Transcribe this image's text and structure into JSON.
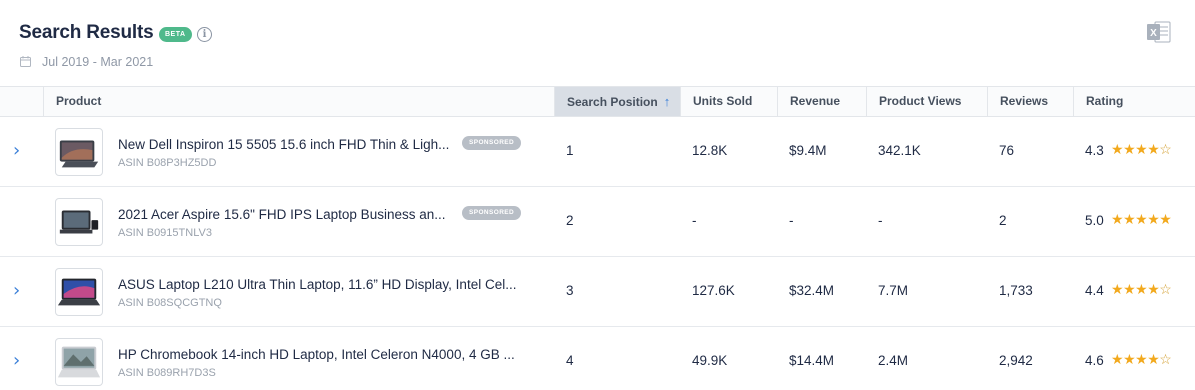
{
  "header": {
    "title": "Search Results",
    "beta_label": "BETA",
    "info_icon": "i",
    "date_range": "Jul 2019 - Mar 2021"
  },
  "columns": [
    {
      "label": "Product"
    },
    {
      "label": "Search Position",
      "sort": "ascending"
    },
    {
      "label": "Units Sold"
    },
    {
      "label": "Revenue"
    },
    {
      "label": "Product Views"
    },
    {
      "label": "Reviews"
    },
    {
      "label": "Rating"
    }
  ],
  "rows": [
    {
      "expandable": true,
      "name": "New Dell Inspiron 15 5505 15.6 inch FHD Thin & Ligh...",
      "asin": "ASIN B08P3HZ5DD",
      "sponsored": "SPONSORED",
      "position": "1",
      "units_sold": "12.8K",
      "revenue": "$9.4M",
      "product_views": "342.1K",
      "reviews": "76",
      "rating": "4.3",
      "stars": 4.3
    },
    {
      "expandable": false,
      "name": "2021 Acer Aspire 15.6\" FHD IPS Laptop Business an...",
      "asin": "ASIN B0915TNLV3",
      "sponsored": "SPONSORED",
      "position": "2",
      "units_sold": "-",
      "revenue": "-",
      "product_views": "-",
      "reviews": "2",
      "rating": "5.0",
      "stars": 5.0
    },
    {
      "expandable": true,
      "name": "ASUS Laptop L210 Ultra Thin Laptop, 11.6” HD Display, Intel Cel...",
      "asin": "ASIN B08SQCGTNQ",
      "sponsored": "",
      "position": "3",
      "units_sold": "127.6K",
      "revenue": "$32.4M",
      "product_views": "7.7M",
      "reviews": "1,733",
      "rating": "4.4",
      "stars": 4.4
    },
    {
      "expandable": true,
      "name": "HP Chromebook 14-inch HD Laptop, Intel Celeron N4000, 4 GB ...",
      "asin": "ASIN B089RH7D3S",
      "sponsored": "",
      "position": "4",
      "units_sold": "49.9K",
      "revenue": "$14.4M",
      "product_views": "2.4M",
      "reviews": "2,942",
      "rating": "4.6",
      "stars": 4.6
    }
  ],
  "colors": {
    "accent": "#3a7fd8",
    "beta": "#4fb98b",
    "star": "#f2a91d",
    "sponsored": "#b8bec6"
  },
  "icons": {
    "info": "info-icon",
    "calendar": "calendar-icon",
    "export": "excel-export-icon",
    "expand": "chevron-right-icon"
  }
}
